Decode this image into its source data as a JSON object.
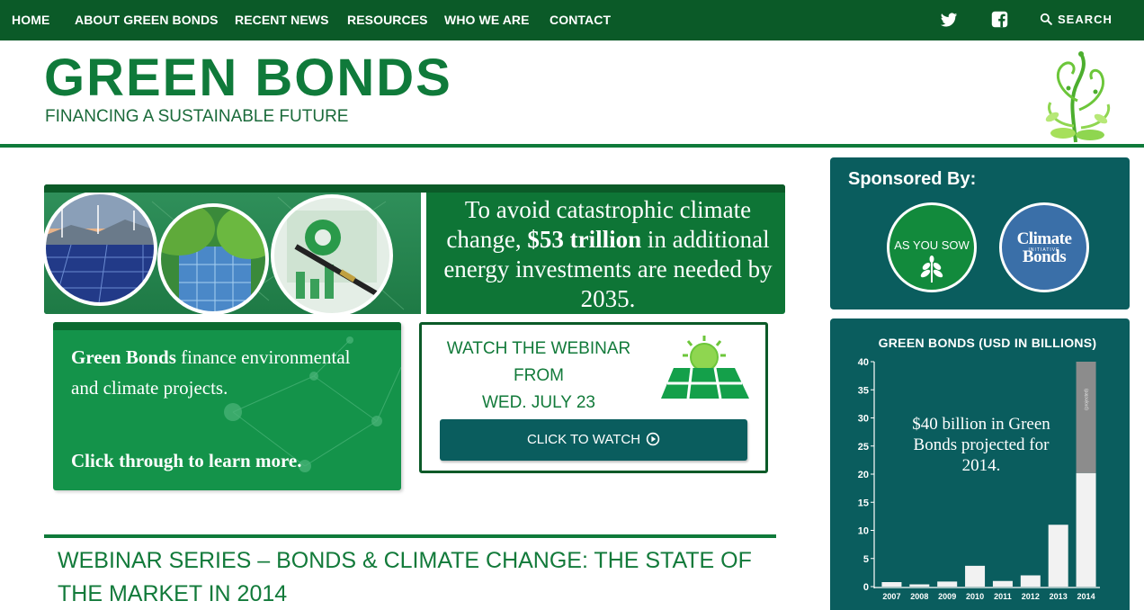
{
  "nav": {
    "items": [
      "HOME",
      "ABOUT GREEN BONDS",
      "RECENT NEWS",
      "RESOURCES",
      "WHO WE ARE",
      "CONTACT"
    ],
    "search_label": "SEARCH",
    "icons": [
      "twitter-icon",
      "facebook-icon",
      "search-icon"
    ]
  },
  "header": {
    "title": "GREEN BONDS",
    "subtitle": "FINANCING A SUSTAINABLE FUTURE"
  },
  "hero": {
    "line1": "To avoid catastrophic climate change, ",
    "highlight": "$53 trillion",
    "line2": " in additional energy investments are needed by 2035."
  },
  "info": {
    "bold_lead": "Green Bonds",
    "text": " finance environmental and climate projects.",
    "cta": "Click through to learn more."
  },
  "webinar": {
    "line1": "WATCH THE WEBINAR",
    "line2": "FROM",
    "line3": "WED. JULY 23",
    "button": "CLICK TO WATCH"
  },
  "article": {
    "title": "WEBINAR SERIES – BONDS & CLIMATE CHANGE: THE STATE OF THE MARKET IN 2014"
  },
  "sidebar": {
    "sponsor_heading": "Sponsored By:",
    "sponsor1": "AS YOU SOW",
    "sponsor2_line1": "Climate",
    "sponsor2_small": "INITIATIVE",
    "sponsor2_line2": "Bonds"
  },
  "colors": {
    "nav": "#0b5a28",
    "brand": "#0f7a3a",
    "teal": "#0a5d5e",
    "grass": "#14934a"
  },
  "chart_data": {
    "type": "bar",
    "title": "GREEN BONDS (USD IN BILLIONS)",
    "categories": [
      "2007",
      "2008",
      "2009",
      "2010",
      "2011",
      "2012",
      "2013",
      "2014"
    ],
    "series": [
      {
        "values": [
          0.8,
          0.4,
          0.9,
          3.7,
          1.0,
          2.0,
          11.0,
          20.2
        ]
      },
      {
        "name": "(projected)",
        "values": [
          0,
          0,
          0,
          0,
          0,
          0,
          0,
          19.8
        ]
      }
    ],
    "ylim": [
      0,
      40
    ],
    "yticks": [
      0,
      5,
      10,
      15,
      20,
      25,
      30,
      35,
      40
    ],
    "annotation": "$40 billion in Green Bonds projected for 2014.",
    "grid": false
  }
}
